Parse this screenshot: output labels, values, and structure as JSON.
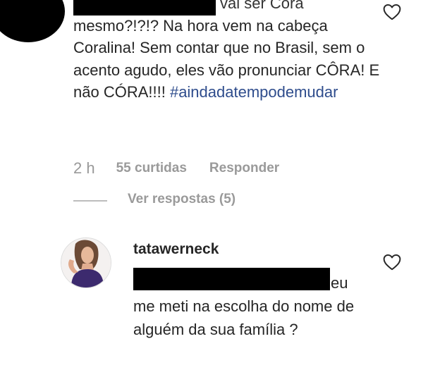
{
  "comment1": {
    "line1_tail": "vai ser Cora",
    "body": "mesmo?!?!? Na hora vem na cabeça Coralina! Sem contar que no Brasil, sem o acento agudo, eles vão pronunciar CÔRA! E não CÓRA!!!! ",
    "hashtag": "#aindadatempodemudar",
    "time": "2 h",
    "likes": "55 curtidas",
    "reply": "Responder",
    "view_replies": "Ver respostas (5)"
  },
  "comment2": {
    "username": "tatawerneck",
    "line1_tail": "eu",
    "body": "me meti na escolha do nome de alguém da sua família ?"
  },
  "icons": {
    "like": "heart-outline-icon"
  }
}
